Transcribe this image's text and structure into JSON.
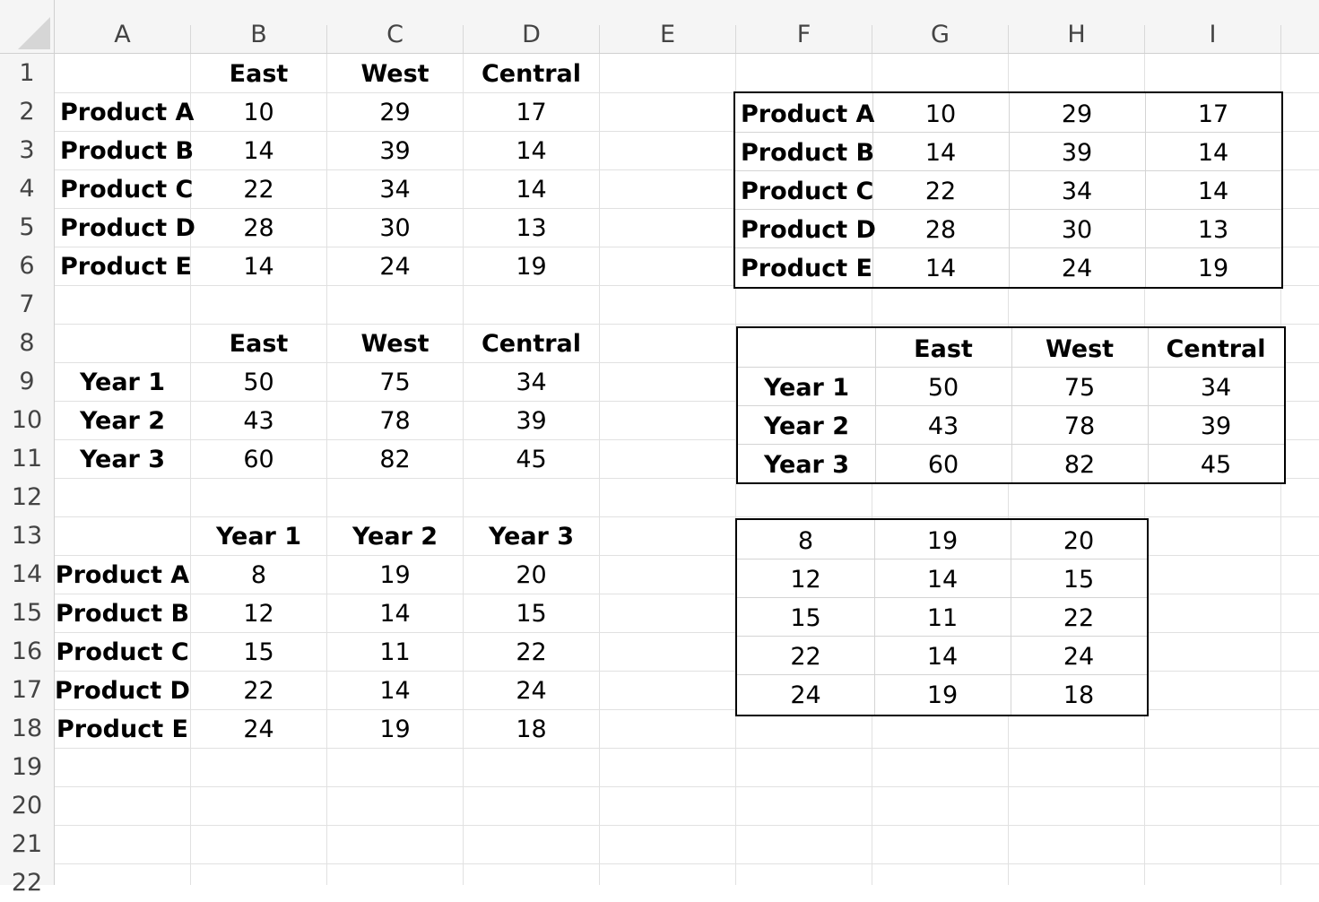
{
  "column_headers": [
    "A",
    "B",
    "C",
    "D",
    "E",
    "F",
    "G",
    "H",
    "I"
  ],
  "row_headers": [
    "1",
    "2",
    "3",
    "4",
    "5",
    "6",
    "7",
    "8",
    "9",
    "10",
    "11",
    "12",
    "13",
    "14",
    "15",
    "16",
    "17",
    "18",
    "19",
    "20",
    "21",
    "22"
  ],
  "table1": {
    "headers": [
      "East",
      "West",
      "Central"
    ],
    "rows": [
      {
        "label": "Product A",
        "values": [
          "10",
          "29",
          "17"
        ]
      },
      {
        "label": "Product B",
        "values": [
          "14",
          "39",
          "14"
        ]
      },
      {
        "label": "Product C",
        "values": [
          "22",
          "34",
          "14"
        ]
      },
      {
        "label": "Product D",
        "values": [
          "28",
          "30",
          "13"
        ]
      },
      {
        "label": "Product E",
        "values": [
          "14",
          "24",
          "19"
        ]
      }
    ]
  },
  "table2": {
    "headers": [
      "East",
      "West",
      "Central"
    ],
    "rows": [
      {
        "label": "Year 1",
        "values": [
          "50",
          "75",
          "34"
        ]
      },
      {
        "label": "Year 2",
        "values": [
          "43",
          "78",
          "39"
        ]
      },
      {
        "label": "Year 3",
        "values": [
          "60",
          "82",
          "45"
        ]
      }
    ]
  },
  "table3": {
    "headers": [
      "Year 1",
      "Year 2",
      "Year 3"
    ],
    "rows": [
      {
        "label": "Product A",
        "values": [
          "8",
          "19",
          "20"
        ]
      },
      {
        "label": "Product B",
        "values": [
          "12",
          "14",
          "15"
        ]
      },
      {
        "label": "Product C",
        "values": [
          "15",
          "11",
          "22"
        ]
      },
      {
        "label": "Product D",
        "values": [
          "22",
          "14",
          "24"
        ]
      },
      {
        "label": "Product E",
        "values": [
          "24",
          "19",
          "18"
        ]
      }
    ]
  },
  "box1": {
    "rows": [
      {
        "label": "Product A",
        "values": [
          "10",
          "29",
          "17"
        ]
      },
      {
        "label": "Product B",
        "values": [
          "14",
          "39",
          "14"
        ]
      },
      {
        "label": "Product C",
        "values": [
          "22",
          "34",
          "14"
        ]
      },
      {
        "label": "Product D",
        "values": [
          "28",
          "30",
          "13"
        ]
      },
      {
        "label": "Product E",
        "values": [
          "14",
          "24",
          "19"
        ]
      }
    ]
  },
  "box2": {
    "headers": [
      "East",
      "West",
      "Central"
    ],
    "rows": [
      {
        "label": "Year 1",
        "values": [
          "50",
          "75",
          "34"
        ]
      },
      {
        "label": "Year 2",
        "values": [
          "43",
          "78",
          "39"
        ]
      },
      {
        "label": "Year 3",
        "values": [
          "60",
          "82",
          "45"
        ]
      }
    ]
  },
  "box3": {
    "rows": [
      [
        "8",
        "19",
        "20"
      ],
      [
        "12",
        "14",
        "15"
      ],
      [
        "15",
        "11",
        "22"
      ],
      [
        "22",
        "14",
        "24"
      ],
      [
        "24",
        "19",
        "18"
      ]
    ]
  }
}
